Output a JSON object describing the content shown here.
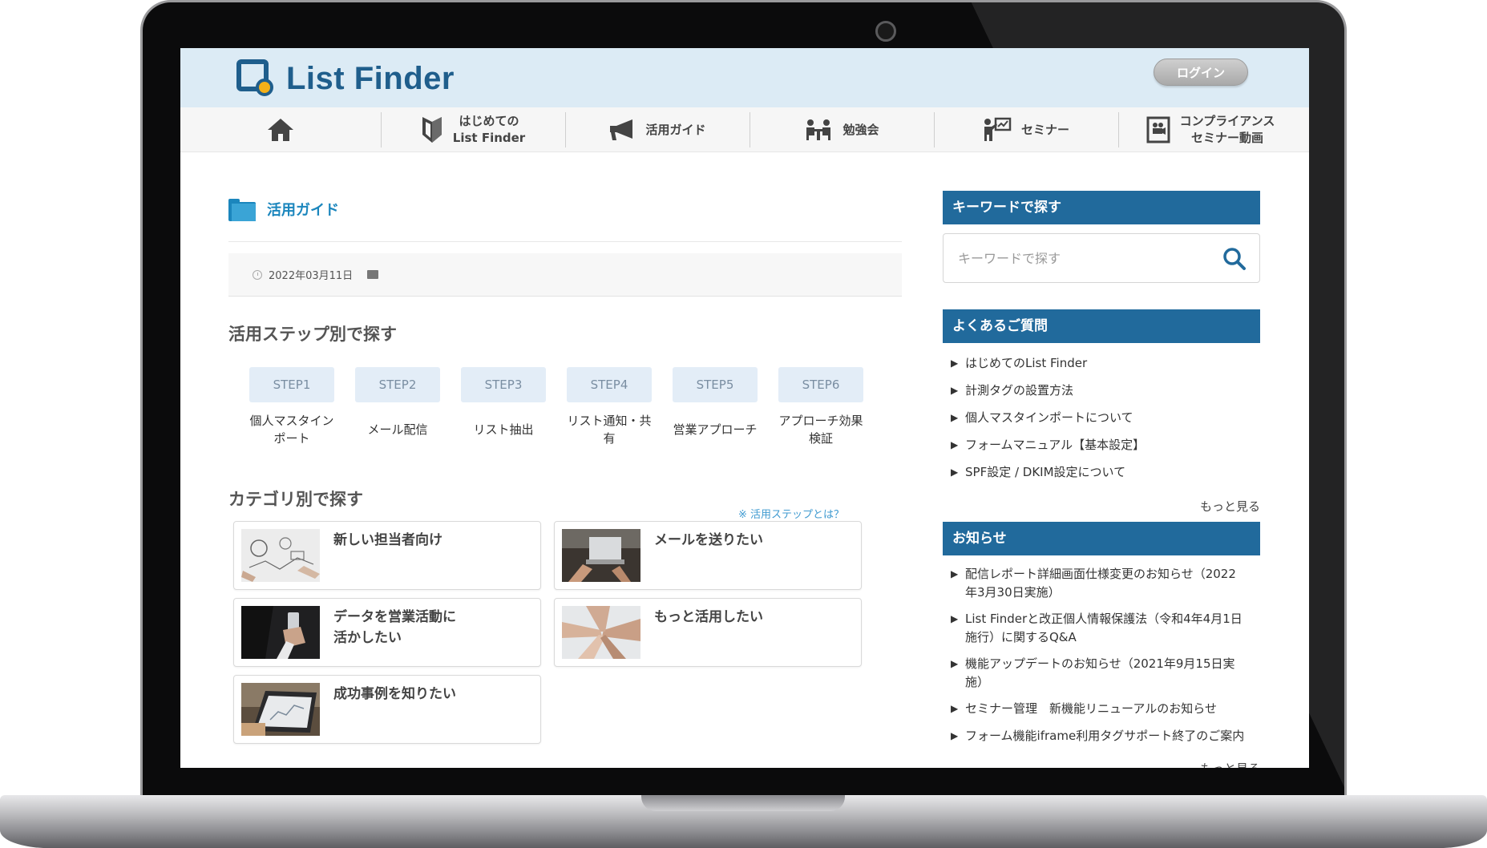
{
  "header": {
    "logo_text": "List Finder",
    "login_label": "ログイン"
  },
  "nav": [
    {
      "label": "",
      "icon": "home-icon"
    },
    {
      "label": "はじめての\nList Finder",
      "icon": "beginner-mark-icon"
    },
    {
      "label": "活用ガイド",
      "icon": "megaphone-icon"
    },
    {
      "label": "勉強会",
      "icon": "study-group-icon"
    },
    {
      "label": "セミナー",
      "icon": "seminar-presenter-icon"
    },
    {
      "label": "コンプライアンス\nセミナー動画",
      "icon": "video-document-icon"
    }
  ],
  "page": {
    "section_title": "活用ガイド",
    "date": "2022年03月11日"
  },
  "steps": {
    "heading": "活用ステップ別で探す",
    "items": [
      {
        "button": "STEP1",
        "label": "個人マスタイン\nポート"
      },
      {
        "button": "STEP2",
        "label": "メール配信"
      },
      {
        "button": "STEP3",
        "label": "リスト抽出"
      },
      {
        "button": "STEP4",
        "label": "リスト通知・共\n有"
      },
      {
        "button": "STEP5",
        "label": "営業アプローチ"
      },
      {
        "button": "STEP6",
        "label": "アプローチ効果\n検証"
      }
    ],
    "note": "※ 活用ステップとは？"
  },
  "categories": {
    "heading": "カテゴリ別で探す",
    "items": [
      {
        "title": "新しい担当者向け"
      },
      {
        "title": "メールを送りたい"
      },
      {
        "title": "データを営業活動に\n活かしたい"
      },
      {
        "title": "もっと活用したい"
      },
      {
        "title": "成功事例を知りたい"
      }
    ]
  },
  "sidebar": {
    "search_heading": "キーワードで探す",
    "search_placeholder": "キーワードで探す",
    "faq_heading": "よくあるご質問",
    "faq_items": [
      "はじめてのList Finder",
      "計測タグの設置方法",
      "個人マスタインポートについて",
      "フォームマニュアル【基本設定】",
      "SPF設定 / DKIM設定について"
    ],
    "faq_more": "もっと見る",
    "news_heading": "お知らせ",
    "news_items": [
      "配信レポート詳細画面仕様変更のお知らせ（2022年3月30日実施）",
      "List Finderと改正個人情報保護法（令和4年4月1日施行）に関するQ&A",
      "機能アップデートのお知らせ（2021年9月15日実施）",
      "セミナー管理　新機能リニューアルのお知らせ",
      "フォーム機能iframe利用タグサポート終了のご案内"
    ],
    "news_more": "もっと見る"
  },
  "colors": {
    "brand": "#1f5e8c",
    "accent": "#1b86bd",
    "sidebar_header": "#216a9c",
    "header_bg": "#dcebf5"
  }
}
